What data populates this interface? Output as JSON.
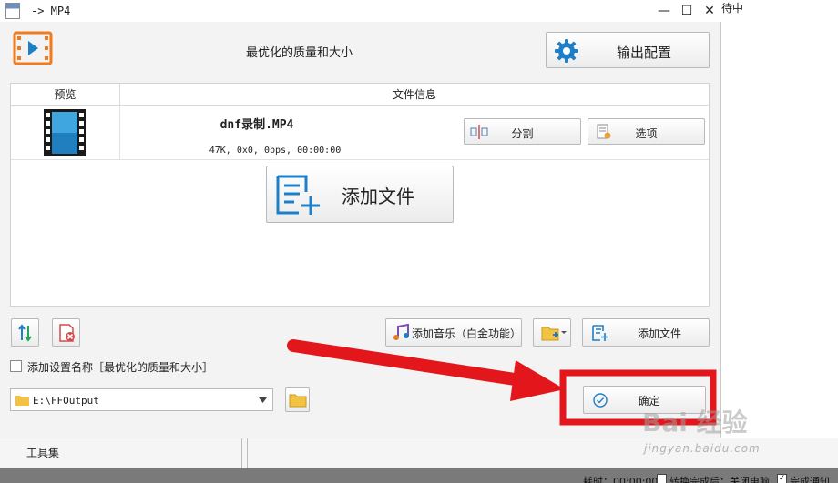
{
  "window": {
    "title": "-> MP4",
    "minimize": "—",
    "maximize": "☐",
    "close": "✕"
  },
  "header": {
    "preset_title": "最优化的质量和大小",
    "output_config_label": "输出配置"
  },
  "file_list": {
    "col_preview": "预览",
    "col_info": "文件信息",
    "rows": [
      {
        "name": "dnf录制.MP4",
        "meta": "47K, 0x0, 0bps, 00:00:00",
        "split_label": "分割",
        "options_label": "选项"
      }
    ]
  },
  "add_file_big_label": "添加文件",
  "bottom": {
    "add_music_label": "添加音乐（白金功能）",
    "add_file_label": "添加文件",
    "preset_name_checkbox_label": "添加设置名称［最优化的质量和大小］",
    "output_path": "E:\\FFOutput",
    "confirm_label": "确定"
  },
  "side_panel": {
    "status_text": "待中"
  },
  "toolbox": {
    "label": "工具集"
  },
  "status_bar": {
    "elapsed": "耗时：00:00:00",
    "shutdown": "转换完成后：关闭电脑",
    "notify": "完成通知",
    "notify_checked": true
  },
  "watermark": {
    "logo_text": "Bai  经验",
    "url": "jingyan.baidu.com"
  },
  "colors": {
    "accent_blue": "#1e7fc9",
    "highlight_red": "#e3161b",
    "logo_orange": "#f07a1e"
  }
}
